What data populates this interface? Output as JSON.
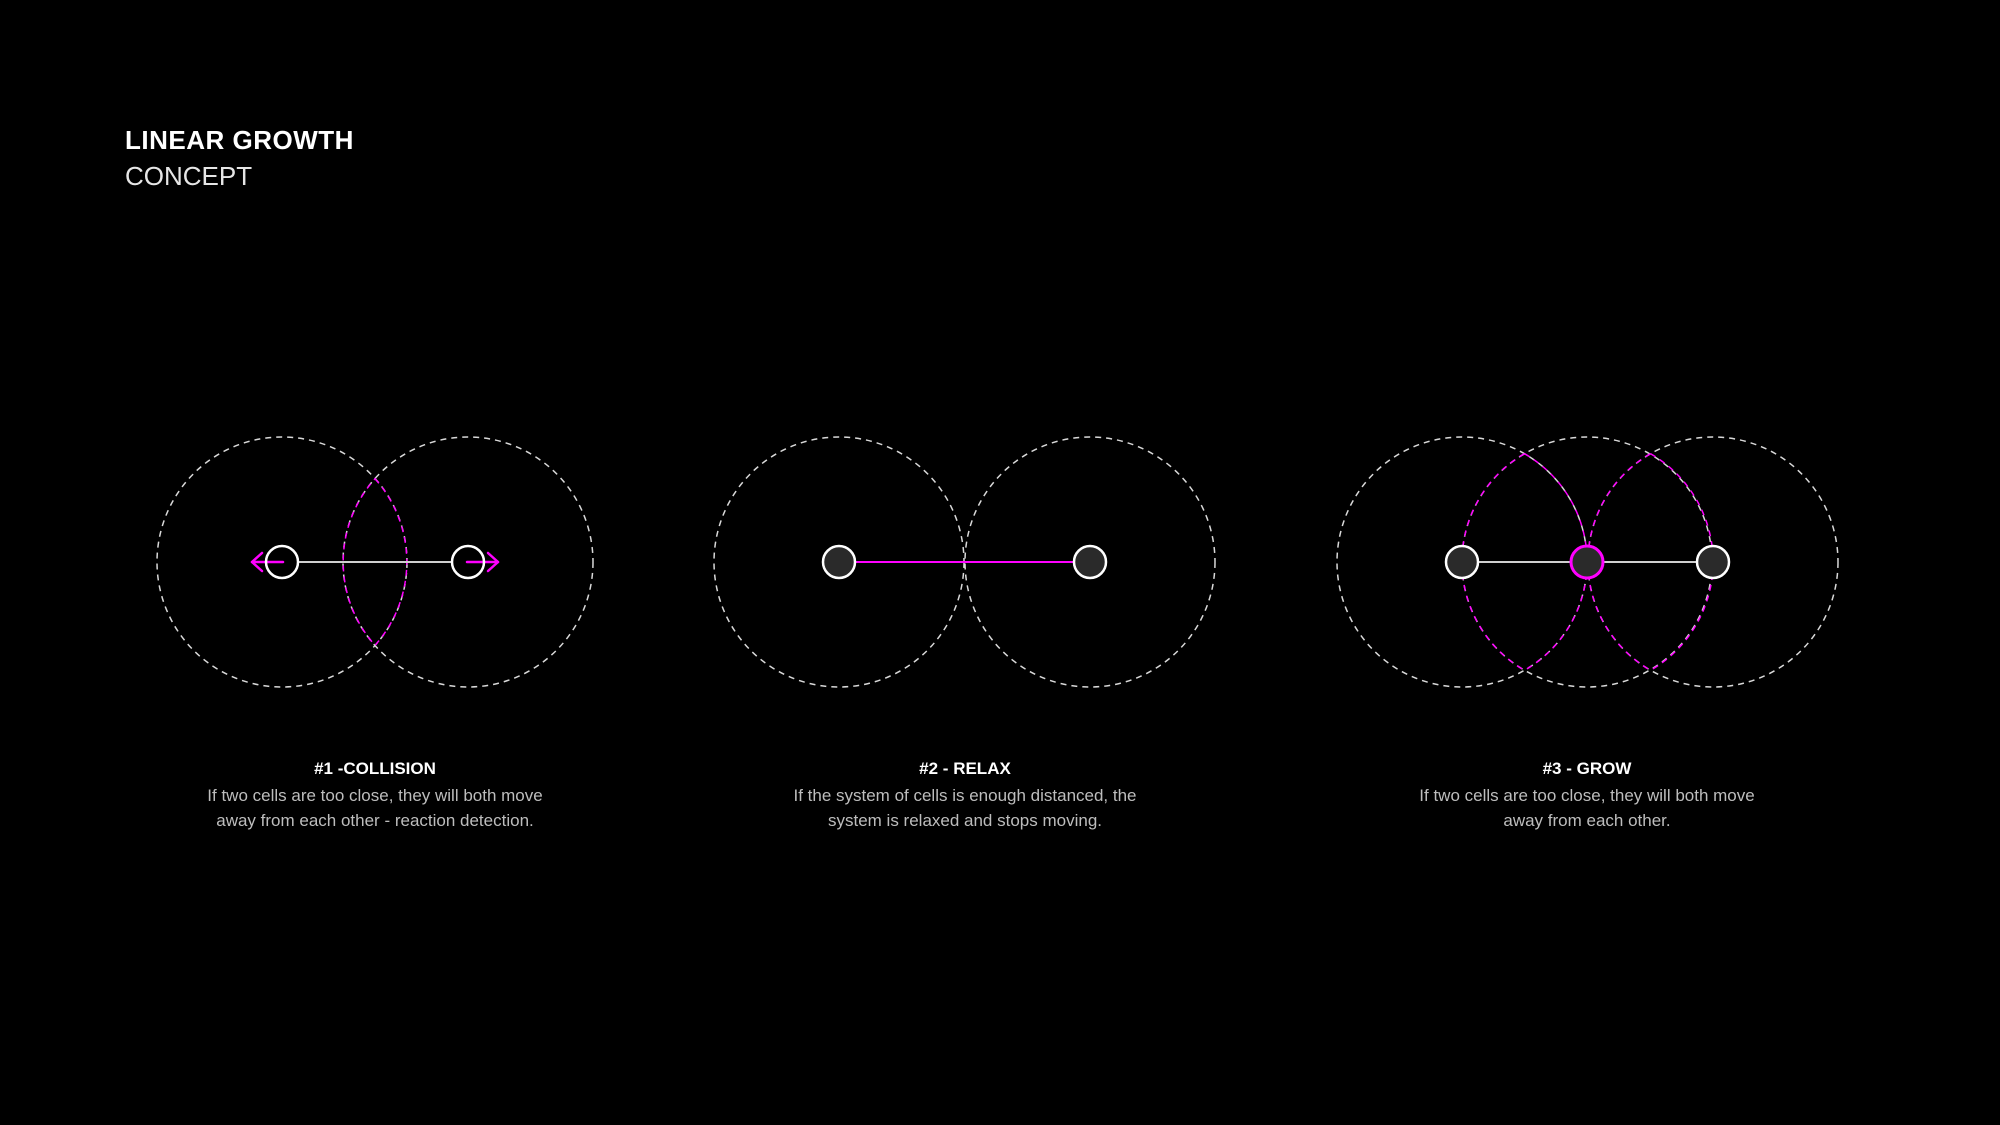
{
  "header": {
    "title": "LINEAR GROWTH",
    "subtitle": "CONCEPT"
  },
  "colors": {
    "background": "#000000",
    "accent": "#ff00ff",
    "outline": "#ffffff",
    "dashed": "#d9d9d9",
    "cell_fill": "#2a2a2a",
    "caption_text": "#bdbdbd"
  },
  "panels": [
    {
      "id": "collision",
      "title": "#1 -COLLISION",
      "text_lines": [
        "If two cells are too close, they will both move",
        "away from each other - reaction detection."
      ],
      "cells": 2,
      "link_color": "white",
      "overlap_highlighted": true,
      "arrows": [
        "outward-left",
        "outward-right"
      ]
    },
    {
      "id": "relax",
      "title": "#2 - RELAX",
      "text_lines": [
        "If the system of cells is enough distanced, the",
        "system is relaxed and stops moving."
      ],
      "cells": 2,
      "link_color": "magenta",
      "overlap_highlighted": false,
      "arrows": []
    },
    {
      "id": "grow",
      "title": "#3 - GROW",
      "text_lines": [
        "If two cells are too close, they will both move",
        "away from each other."
      ],
      "cells": 3,
      "link_color": "white",
      "new_cell_highlighted": true,
      "arrows": []
    }
  ]
}
